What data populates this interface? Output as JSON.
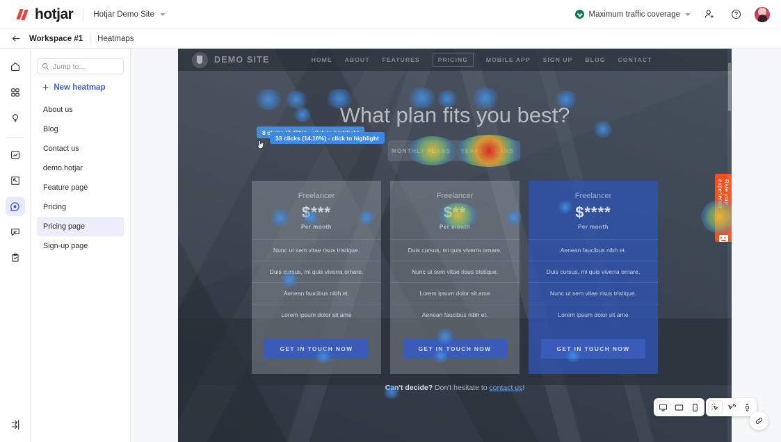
{
  "header": {
    "brand": "hotjar",
    "site_selector": "Hotjar Demo Site",
    "coverage": "Maximum traffic coverage",
    "invite_icon": "add-user-icon",
    "help_icon": "help-circle-icon",
    "avatar_icon": "user-avatar"
  },
  "breadcrumb": {
    "back_icon": "back-arrow-icon",
    "workspace": "Workspace #1",
    "current": "Heatmaps"
  },
  "rail": {
    "items": [
      {
        "name": "home-icon",
        "label": "Home",
        "active": false
      },
      {
        "name": "dashboard-icon",
        "label": "Dashboards",
        "active": false
      },
      {
        "name": "lightbulb-icon",
        "label": "Highlights",
        "active": false
      },
      {
        "name": "trends-icon",
        "label": "Trends",
        "active": false
      },
      {
        "name": "recordings-icon",
        "label": "Recordings",
        "active": false
      },
      {
        "name": "heatmaps-icon",
        "label": "Heatmaps",
        "active": true
      },
      {
        "name": "feedback-icon",
        "label": "Feedback",
        "active": false
      },
      {
        "name": "surveys-icon",
        "label": "Surveys",
        "active": false
      }
    ],
    "bottom_icon": "collapse-panel-icon"
  },
  "panel": {
    "search_placeholder": "Jump to...",
    "search_value": "",
    "search_icon": "search-icon",
    "new_button": "New heatmap",
    "plus_icon": "plus-icon",
    "items": [
      {
        "label": "About us",
        "selected": false
      },
      {
        "label": "Blog",
        "selected": false
      },
      {
        "label": "Contact us",
        "selected": false
      },
      {
        "label": "demo.hotjar",
        "selected": false
      },
      {
        "label": "Feature page",
        "selected": false
      },
      {
        "label": "Pricing",
        "selected": false
      },
      {
        "label": "Pricing page",
        "selected": true
      },
      {
        "label": "Sign-up page",
        "selected": false
      }
    ]
  },
  "page": {
    "nav": {
      "logo_label": "DEMO SITE",
      "links": [
        "HOME",
        "ABOUT",
        "FEATURES",
        "PRICING",
        "MOBILE APP",
        "SIGN UP",
        "BLOG",
        "CONTACT"
      ],
      "boxed_link": "PRICING"
    },
    "hero_title": "What plan fits you best?",
    "toggle": [
      "MONTHLY PLANS",
      "YEARLY PLANS"
    ],
    "cards": [
      {
        "title": "Freelancer",
        "price": "$***",
        "period": "Per month",
        "features": [
          "Nunc ut sem vitae risus tristique.",
          "Duis cursus, mi quis viverra ornare.",
          "Aenean faucibus nibh et.",
          "Lorem ipsum dolor sit ame"
        ],
        "cta": "GET IN TOUCH NOW",
        "featured": false
      },
      {
        "title": "Freelancer",
        "price": "$**",
        "period": "Per month",
        "features": [
          "Duis cursus, mi quis viverra ornare.",
          "Nunc ut sem vitae risus tristique.",
          "Lorem ipsum dolor sit ame",
          "Aenean faucibus nibh et."
        ],
        "cta": "GET IN TOUCH NOW",
        "featured": false
      },
      {
        "title": "Freelancer",
        "price": "$****",
        "period": "Per month",
        "features": [
          "Aenean faucibus nibh et.",
          "Duis cursus, mi quis viverra ornare.",
          "Nunc ut sem vitae risus tristique.",
          "Lorem ipsum dolor sit ame"
        ],
        "cta": "GET IN TOUCH NOW",
        "featured": true
      }
    ],
    "footer_note": {
      "bold": "Can't decide?",
      "text": " Don't hesitate to ",
      "link": "contact us",
      "tail": "!"
    },
    "feedback_widget": "Rate your experience"
  },
  "heatmap": {
    "tooltip_back": "8 clicks (3.43%) - click to highlight",
    "tooltip_front": "33 clicks (14.16%) - click to highlight",
    "cursor_icon": "pointer-hand-icon"
  },
  "toolbar": {
    "devices": [
      {
        "name": "desktop-icon",
        "label": "Desktop",
        "active": true
      },
      {
        "name": "tablet-icon",
        "label": "Tablet",
        "active": false
      },
      {
        "name": "mobile-icon",
        "label": "Mobile",
        "active": false
      }
    ],
    "modes": [
      {
        "name": "click-map-icon",
        "label": "Click",
        "active": true
      },
      {
        "name": "move-map-icon",
        "label": "Move",
        "active": false
      },
      {
        "name": "scroll-map-icon",
        "label": "Scroll",
        "active": false
      }
    ],
    "link_icon": "share-link-icon"
  }
}
